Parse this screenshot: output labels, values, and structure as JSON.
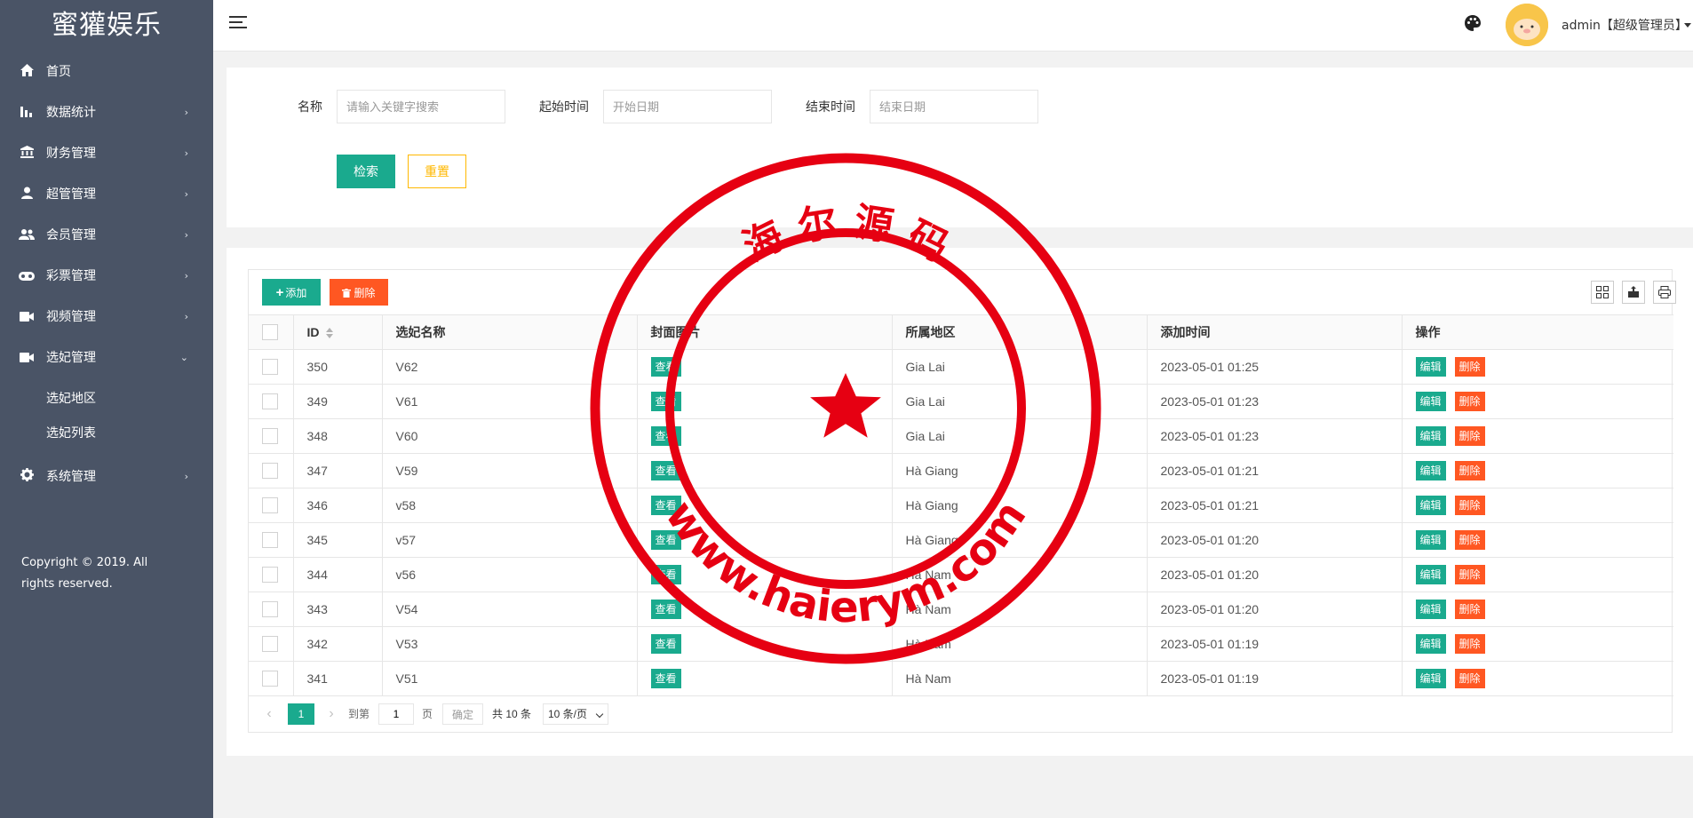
{
  "brand": "蜜獾娱乐",
  "sidebar": {
    "items": [
      {
        "label": "首页",
        "icon": "home-icon"
      },
      {
        "label": "数据统计",
        "icon": "bar-chart-icon"
      },
      {
        "label": "财务管理",
        "icon": "bank-icon"
      },
      {
        "label": "超管管理",
        "icon": "user-icon"
      },
      {
        "label": "会员管理",
        "icon": "users-icon"
      },
      {
        "label": "彩票管理",
        "icon": "gamepad-icon"
      },
      {
        "label": "视频管理",
        "icon": "video-icon"
      },
      {
        "label": "选妃管理",
        "icon": "video-icon",
        "expanded": true
      },
      {
        "label": "系统管理",
        "icon": "gear-icon"
      }
    ],
    "submenu": [
      "选妃地区",
      "选妃列表"
    ],
    "footer": "Copyright © 2019. All rights reserved."
  },
  "header": {
    "user_label": "admin【超级管理员】",
    "avatar_color": "#f8c54a"
  },
  "search": {
    "name_label": "名称",
    "name_placeholder": "请输入关键字搜索",
    "start_label": "起始时间",
    "start_placeholder": "开始日期",
    "end_label": "结束时间",
    "end_placeholder": "结束日期",
    "search_button": "检索",
    "reset_button": "重置"
  },
  "toolbar": {
    "add_label": "添加",
    "delete_label": "删除"
  },
  "table": {
    "headers": [
      "ID",
      "选妃名称",
      "封面图片",
      "所属地区",
      "添加时间",
      "操作"
    ],
    "view_label": "查看",
    "edit_label": "编辑",
    "delete_label": "删除",
    "rows": [
      {
        "id": "350",
        "name": "V62",
        "region": "Gia Lai",
        "time": "2023-05-01 01:25"
      },
      {
        "id": "349",
        "name": "V61",
        "region": "Gia Lai",
        "time": "2023-05-01 01:23"
      },
      {
        "id": "348",
        "name": "V60",
        "region": "Gia Lai",
        "time": "2023-05-01 01:23"
      },
      {
        "id": "347",
        "name": "V59",
        "region": "Hà Giang",
        "time": "2023-05-01 01:21"
      },
      {
        "id": "346",
        "name": "v58",
        "region": "Hà Giang",
        "time": "2023-05-01 01:21"
      },
      {
        "id": "345",
        "name": "v57",
        "region": "Hà Giang",
        "time": "2023-05-01 01:20"
      },
      {
        "id": "344",
        "name": "v56",
        "region": "Hà Nam",
        "time": "2023-05-01 01:20"
      },
      {
        "id": "343",
        "name": "V54",
        "region": "Hà Nam",
        "time": "2023-05-01 01:20"
      },
      {
        "id": "342",
        "name": "V53",
        "region": "Hà Nam",
        "time": "2023-05-01 01:19"
      },
      {
        "id": "341",
        "name": "V51",
        "region": "Hà Nam",
        "time": "2023-05-01 01:19"
      }
    ]
  },
  "pager": {
    "current_page": "1",
    "goto_label": "到第",
    "page_input": "1",
    "page_unit": "页",
    "confirm": "确定",
    "total": "共 10 条",
    "page_size": "10 条/页"
  },
  "watermark": {
    "top_text": "海 尔 源 码",
    "bottom_text": "www.haierym.com",
    "color": "#e60012"
  },
  "colors": {
    "sidebar_bg": "#4a5466",
    "primary": "#1aaa8e",
    "danger": "#ff5722",
    "warning": "#ffb800"
  }
}
